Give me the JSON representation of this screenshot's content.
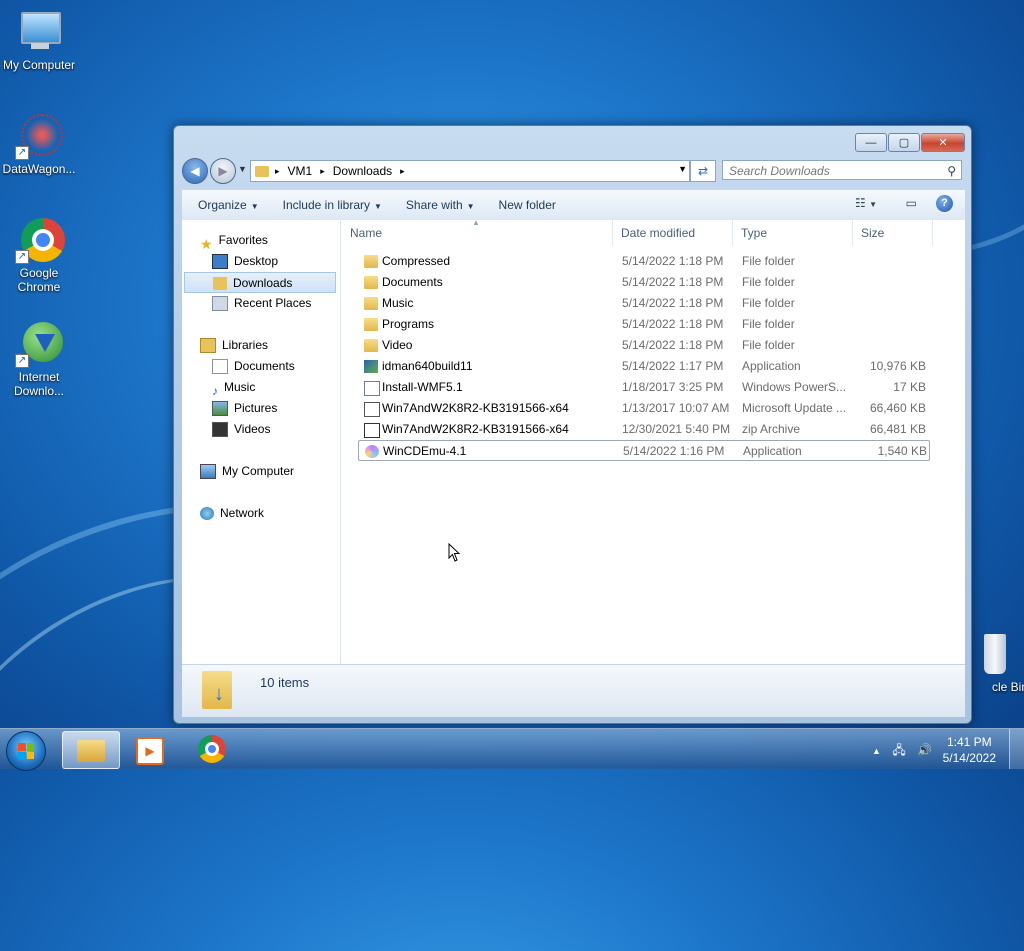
{
  "desktop": {
    "icons": [
      {
        "label": "My Computer"
      },
      {
        "label": "DataWagon..."
      },
      {
        "label": "Google Chrome"
      },
      {
        "label": "Internet Downlo..."
      },
      {
        "label": "cle Bin"
      }
    ]
  },
  "window": {
    "controls": {
      "minimize": "—",
      "maximize": "▢",
      "close": "✕"
    },
    "address": {
      "crumbs": [
        "VM1",
        "Downloads"
      ],
      "sep": "▸"
    },
    "search": {
      "placeholder": "Search Downloads"
    },
    "toolbar": {
      "organize": "Organize",
      "include": "Include in library",
      "share": "Share with",
      "new_folder": "New folder",
      "help": "?"
    },
    "nav": {
      "favorites": "Favorites",
      "desktop": "Desktop",
      "downloads": "Downloads",
      "recent": "Recent Places",
      "libraries": "Libraries",
      "documents": "Documents",
      "music": "Music",
      "pictures": "Pictures",
      "videos": "Videos",
      "computer": "My Computer",
      "network": "Network"
    },
    "columns": {
      "name": "Name",
      "date": "Date modified",
      "type": "Type",
      "size": "Size"
    },
    "files": [
      {
        "name": "Compressed",
        "date": "5/14/2022 1:18 PM",
        "type": "File folder",
        "size": "",
        "icon": "folder-icon"
      },
      {
        "name": "Documents",
        "date": "5/14/2022 1:18 PM",
        "type": "File folder",
        "size": "",
        "icon": "folder-icon"
      },
      {
        "name": "Music",
        "date": "5/14/2022 1:18 PM",
        "type": "File folder",
        "size": "",
        "icon": "folder-icon"
      },
      {
        "name": "Programs",
        "date": "5/14/2022 1:18 PM",
        "type": "File folder",
        "size": "",
        "icon": "folder-icon"
      },
      {
        "name": "Video",
        "date": "5/14/2022 1:18 PM",
        "type": "File folder",
        "size": "",
        "icon": "folder-icon"
      },
      {
        "name": "idman640build11",
        "date": "5/14/2022 1:17 PM",
        "type": "Application",
        "size": "10,976 KB",
        "icon": "installer-icon"
      },
      {
        "name": "Install-WMF5.1",
        "date": "1/18/2017 3:25 PM",
        "type": "Windows PowerS...",
        "size": "17 KB",
        "icon": "script-icon"
      },
      {
        "name": "Win7AndW2K8R2-KB3191566-x64",
        "date": "1/13/2017 10:07 AM",
        "type": "Microsoft Update ...",
        "size": "66,460 KB",
        "icon": "update-icon"
      },
      {
        "name": "Win7AndW2K8R2-KB3191566-x64",
        "date": "12/30/2021 5:40 PM",
        "type": "zip Archive",
        "size": "66,481 KB",
        "icon": "zip-icon"
      },
      {
        "name": "WinCDEmu-4.1",
        "date": "5/14/2022 1:16 PM",
        "type": "Application",
        "size": "1,540 KB",
        "icon": "cd-icon"
      }
    ],
    "status": "10 items"
  },
  "taskbar": {
    "time": "1:41 PM",
    "date": "5/14/2022"
  }
}
